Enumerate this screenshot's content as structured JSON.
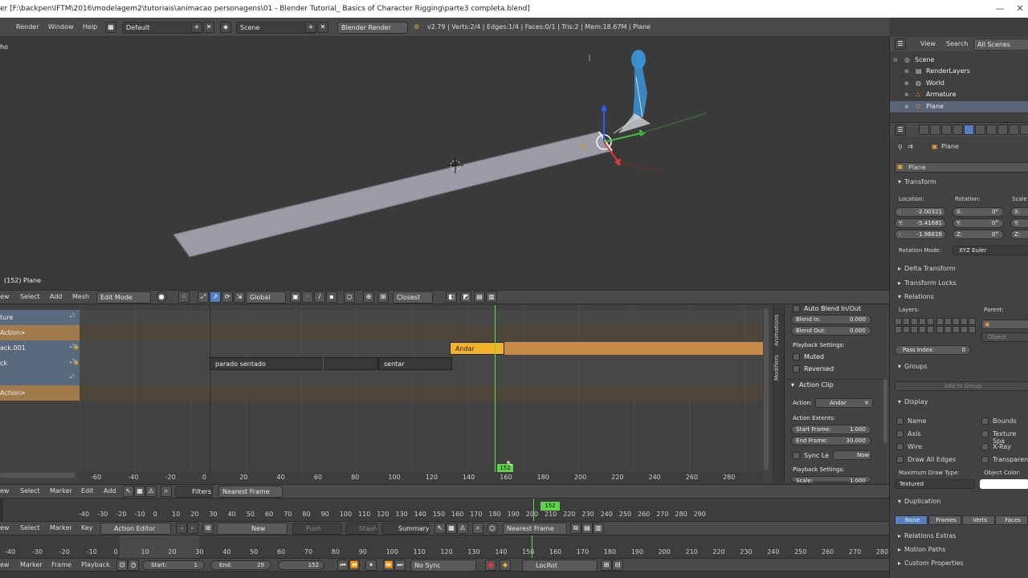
{
  "titlebar": {
    "title": "er [F:\\backpen\\IFTM\\2016\\modelagem2\\tutoriais\\animacao personagens\\01 - Blender Tutorial_ Basics of Character Rigging\\parte3 completa.blend]",
    "min": "—",
    "max": "☐",
    "close": "✕"
  },
  "topbar": {
    "menus": [
      "Render",
      "Window",
      "Help"
    ],
    "layout": "Default",
    "scene": "Scene",
    "engine": "Blender Render",
    "stats": "v2.79 | Verts:2/4 | Edges:1/4 | Faces:0/1 | Tris:2 | Mem:18.67M | Plane"
  },
  "viewport": {
    "corner_text": "ho",
    "object_label": "(152) Plane",
    "header": {
      "menus": [
        "ew",
        "Select",
        "Add",
        "Mesh"
      ],
      "mode": "Edit Mode",
      "orientation": "Global",
      "snap": "Closest"
    }
  },
  "nla": {
    "tracks": [
      {
        "name": "ture",
        "color": "#5a6a7e"
      },
      {
        "name": "Action>",
        "color": "#a17b4a"
      },
      {
        "name": "ack.001",
        "color": "#5a6a7e"
      },
      {
        "name": "ck",
        "color": "#5a6a7e"
      },
      {
        "name": "",
        "color": "#5a6a7e"
      },
      {
        "name": "Action>",
        "color": "#a17b4a"
      }
    ],
    "strips": {
      "andar": "Andar",
      "parado": "parado sentado",
      "sentar": "sentar"
    },
    "ruler": [
      "-60",
      "-40",
      "-20",
      "0",
      "20",
      "40",
      "60",
      "80",
      "100",
      "120",
      "140",
      "160",
      "180",
      "200",
      "220",
      "240",
      "260",
      "280"
    ],
    "frame_marker": "152",
    "header": {
      "menus": [
        "ew",
        "Select",
        "Marker",
        "Edit",
        "Add"
      ],
      "filters": "Filters",
      "snap": "Nearest Frame"
    },
    "side_tabs": [
      "Animations",
      "Modifiers"
    ],
    "props": {
      "auto_blend": "Auto Blend In/Out",
      "blend_in_label": "Blend In:",
      "blend_in": "0.000",
      "blend_out_label": "Blend Out:",
      "blend_out": "0.000",
      "playback_settings": "Playback Settings:",
      "muted": "Muted",
      "reversed": "Reversed",
      "action_clip": "Action Clip",
      "action_label": "Action:",
      "action": "Andar",
      "extents": "Action Extents:",
      "start_label": "Start Frame:",
      "start": "1.000",
      "end_label": "End Frame:",
      "end": "30.000",
      "sync_len": "Sync Le",
      "now": "Now",
      "playback2": "Playback Settings:",
      "scale_label": "Scale:",
      "scale": "1.000"
    }
  },
  "dopesheet": {
    "ruler": [
      "-40",
      "-30",
      "-20",
      "-10",
      "0",
      "10",
      "20",
      "30",
      "40",
      "50",
      "60",
      "70",
      "80",
      "90",
      "100",
      "110",
      "120",
      "130",
      "140",
      "150",
      "160",
      "170",
      "180",
      "190",
      "200",
      "210",
      "220",
      "230",
      "240",
      "250",
      "260",
      "270",
      "280",
      "290"
    ],
    "current_frame": "152",
    "header": {
      "menus": [
        "ew",
        "Select",
        "Marker",
        "Key"
      ],
      "mode": "Action Editor",
      "new": "New",
      "push_down": "Push Down",
      "stash": "Stash",
      "summary": "Summary",
      "snap": "Nearest Frame"
    }
  },
  "timeline": {
    "ruler": [
      "-40",
      "-30",
      "-20",
      "-10",
      "0",
      "10",
      "20",
      "30",
      "40",
      "50",
      "60",
      "70",
      "80",
      "90",
      "100",
      "110",
      "120",
      "130",
      "140",
      "150",
      "160",
      "170",
      "180",
      "190",
      "200",
      "210",
      "220",
      "230",
      "240",
      "250",
      "260",
      "270",
      "280"
    ],
    "header": {
      "menus": [
        "ew",
        "Marker",
        "Frame",
        "Playback"
      ],
      "start_label": "Start:",
      "start": "1",
      "end_label": "End:",
      "end": "29",
      "frame": "152",
      "sync": "No Sync",
      "keying": "LocRot"
    }
  },
  "outliner": {
    "header": {
      "view": "View",
      "search": "Search",
      "filter": "All Scenes"
    },
    "items": [
      {
        "label": "Scene",
        "indent": 0
      },
      {
        "label": "RenderLayers",
        "indent": 1
      },
      {
        "label": "World",
        "indent": 1
      },
      {
        "label": "Armature",
        "indent": 1
      },
      {
        "label": "Plane",
        "indent": 1
      }
    ]
  },
  "properties": {
    "breadcrumb": "Plane",
    "object_name": "Plane",
    "transform": "Transform",
    "location_label": "Location:",
    "rotation_label": "Rotation:",
    "scale_label": "Scale",
    "loc": [
      "-2.00321",
      "-5.41681",
      "-1.96816"
    ],
    "loc_prefix": [
      ":",
      "Y:",
      ":"
    ],
    "rot_axis": [
      "X:",
      "Y:",
      "Z:"
    ],
    "rot": [
      "0°",
      "0°",
      "0°"
    ],
    "scale_axis": [
      "X:",
      "Y:",
      "Z:"
    ],
    "rotation_mode_label": "Rotation Mode:",
    "rotation_mode": "XYZ Euler",
    "delta": "Delta Transform",
    "locks": "Transform Locks",
    "relations": "Relations",
    "layers_label": "Layers:",
    "parent_label": "Parent:",
    "object_type": "Object",
    "pass_index_label": "Pass Index:",
    "pass_index": "0",
    "groups": "Groups",
    "add_group": "Add to Group",
    "display": "Display",
    "display_left": [
      "Name",
      "Axis",
      "Wire",
      "Draw All Edges"
    ],
    "display_right": [
      "Bounds",
      "Texture Spa",
      "X-Ray",
      "Transparenc"
    ],
    "max_draw_label": "Maximum Draw Type:",
    "max_draw": "Textured",
    "obj_color_label": "Object Color:",
    "duplication": "Duplication",
    "dup_tabs": [
      "None",
      "Frames",
      "Verts",
      "Faces"
    ],
    "relations_extras": "Relations Extras",
    "motion_paths": "Motion Paths",
    "custom_props": "Custom Properties"
  }
}
